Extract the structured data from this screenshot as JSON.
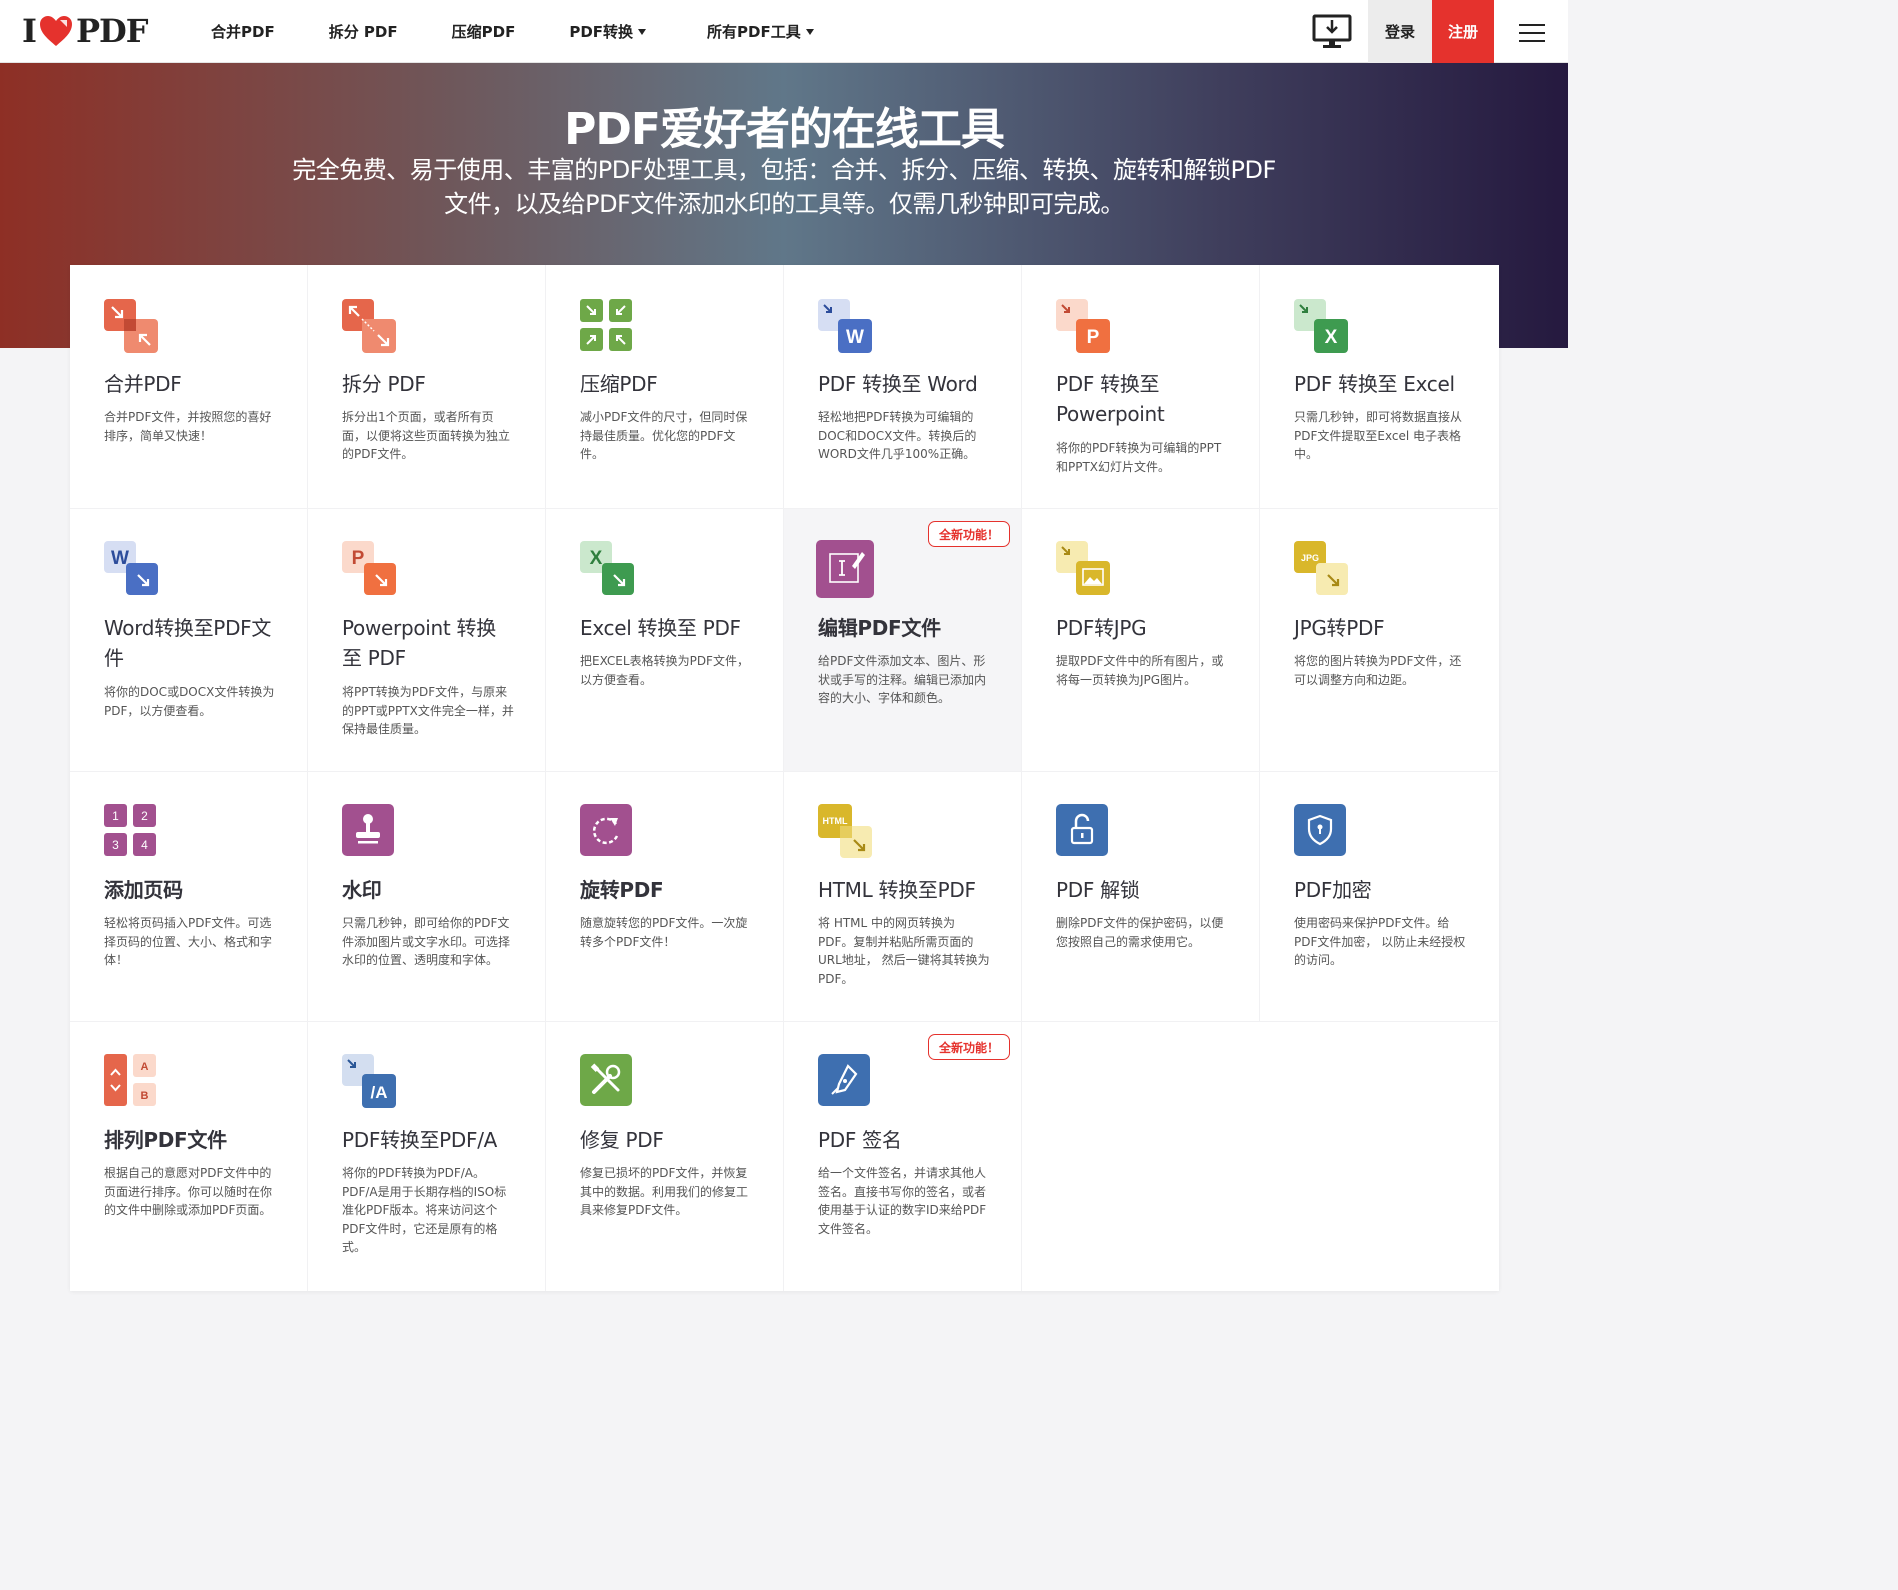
{
  "header": {
    "logo_left": "I",
    "logo_right": "PDF",
    "nav": [
      {
        "label": "合并PDF",
        "caret": false
      },
      {
        "label": "拆分 PDF",
        "caret": false
      },
      {
        "label": "压缩PDF",
        "caret": false
      },
      {
        "label": "PDF转换",
        "caret": true
      },
      {
        "label": "所有PDF工具",
        "caret": true
      }
    ],
    "login": "登录",
    "signup": "注册"
  },
  "hero": {
    "title": "PDF爱好者的在线工具",
    "subtitle": "完全免费、易于使用、丰富的PDF处理工具，包括：合并、拆分、压缩、转换、旋转和解锁PDF文件，以及给PDF文件添加水印的工具等。仅需几秒钟即可完成。"
  },
  "tools": [
    {
      "title": "合并PDF",
      "desc": "合并PDF文件，并按照您的喜好排序，简单又快速！",
      "icon": "merge-icon",
      "color": "#e5664b"
    },
    {
      "title": "拆分 PDF",
      "desc": "拆分出1个页面，或者所有页面，以便将这些页面转换为独立的PDF文件。",
      "icon": "split-icon",
      "color": "#e5664b"
    },
    {
      "title": "压缩PDF",
      "desc": "减小PDF文件的尺寸，但同时保持最佳质量。优化您的PDF文件。",
      "icon": "compress-icon",
      "color": "#6ea848"
    },
    {
      "title": "PDF 转换至 Word",
      "desc": "轻松地把PDF转换为可编辑的DOC和DOCX文件。转换后的WORD文件几乎100%正确。",
      "icon": "pdf-to-word-icon",
      "color": "#4a6fc4"
    },
    {
      "title": "PDF 转换至 Powerpoint",
      "desc": "将你的PDF转换为可编辑的PPT和PPTX幻灯片文件。",
      "icon": "pdf-to-ppt-icon",
      "color": "#f07040"
    },
    {
      "title": "PDF 转换至 Excel",
      "desc": "只需几秒钟，即可将数据直接从PDF文件提取至Excel 电子表格中。",
      "icon": "pdf-to-excel-icon",
      "color": "#3e9b50"
    },
    {
      "title": "Word转换至PDF文件",
      "desc": "将你的DOC或DOCX文件转换为PDF，以方便查看。",
      "icon": "word-to-pdf-icon",
      "color": "#4a6fc4"
    },
    {
      "title": "Powerpoint 转换至 PDF",
      "desc": "将PPT转换为PDF文件，与原来的PPT或PPTX文件完全一样，并保持最佳质量。",
      "icon": "ppt-to-pdf-icon",
      "color": "#f07040"
    },
    {
      "title": "Excel 转换至 PDF",
      "desc": "把EXCEL表格转换为PDF文件，以方便查看。",
      "icon": "excel-to-pdf-icon",
      "color": "#3e9b50"
    },
    {
      "title": "编辑PDF文件",
      "desc": "给PDF文件添加文本、图片、形状或手写的注释。编辑已添加内容的大小、字体和颜色。",
      "icon": "edit-pdf-icon",
      "color": "#a2508f",
      "badge": "全新功能！"
    },
    {
      "title": "PDF转JPG",
      "desc": "提取PDF文件中的所有图片，或将每一页转换为JPG图片。",
      "icon": "pdf-to-jpg-icon",
      "color": "#d9b72b"
    },
    {
      "title": "JPG转PDF",
      "desc": "将您的图片转换为PDF文件，还可以调整方向和边距。",
      "icon": "jpg-to-pdf-icon",
      "color": "#d9b72b"
    },
    {
      "title": "添加页码",
      "desc": "轻松将页码插入PDF文件。可选择页码的位置、大小、格式和字体！",
      "icon": "page-numbers-icon",
      "color": "#a2508f"
    },
    {
      "title": "水印",
      "desc": "只需几秒钟，即可给你的PDF文件添加图片或文字水印。可选择水印的位置、透明度和字体。",
      "icon": "watermark-icon",
      "color": "#a2508f"
    },
    {
      "title": "旋转PDF",
      "desc": "随意旋转您的PDF文件。一次旋转多个PDF文件！",
      "icon": "rotate-icon",
      "color": "#a2508f"
    },
    {
      "title": "HTML 转换至PDF",
      "desc": "将 HTML 中的网页转换为PDF。复制并粘贴所需页面的URL地址， 然后一键将其转换为 PDF。",
      "icon": "html-to-pdf-icon",
      "color": "#d9b72b"
    },
    {
      "title": "PDF 解锁",
      "desc": "删除PDF文件的保护密码，以便您按照自己的需求使用它。",
      "icon": "unlock-icon",
      "color": "#3e6fb0"
    },
    {
      "title": "PDF加密",
      "desc": "使用密码来保护PDF文件。给PDF文件加密， 以防止未经授权的访问。",
      "icon": "protect-icon",
      "color": "#3e6fb0"
    },
    {
      "title": "排列PDF文件",
      "desc": "根据自己的意愿对PDF文件中的页面进行排序。你可以随时在你的文件中删除或添加PDF页面。",
      "icon": "organize-icon",
      "color": "#e5664b"
    },
    {
      "title": "PDF转换至PDF/A",
      "desc": "将你的PDF转换为PDF/A。PDF/A是用于长期存档的ISO标准化PDF版本。将来访问这个PDF文件时，它还是原有的格式。",
      "icon": "pdfa-icon",
      "color": "#3e6fb0"
    },
    {
      "title": "修复 PDF",
      "desc": "修复已损坏的PDF文件，并恢复其中的数据。利用我们的修复工具来修复PDF文件。",
      "icon": "repair-icon",
      "color": "#6ea848"
    },
    {
      "title": "PDF 签名",
      "desc": "给一个文件签名，并请求其他人签名。直接书写你的签名，或者使用基于认证的数字ID来给PDF文件签名。",
      "icon": "sign-icon",
      "color": "#3e6fb0",
      "badge": "全新功能！"
    }
  ]
}
